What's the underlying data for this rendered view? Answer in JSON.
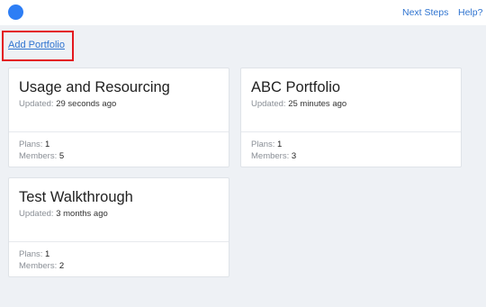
{
  "header": {
    "next_steps": "Next Steps",
    "help": "Help?"
  },
  "main": {
    "add_portfolio": "Add Portfolio",
    "updated_label": "Updated:",
    "plans_label": "Plans:",
    "members_label": "Members:",
    "portfolios": [
      {
        "title": "Usage and Resourcing",
        "updated": "29 seconds ago",
        "plans": "1",
        "members": "5"
      },
      {
        "title": "ABC Portfolio",
        "updated": "25 minutes ago",
        "plans": "1",
        "members": "3"
      },
      {
        "title": "Test Walkthrough",
        "updated": "3 months ago",
        "plans": "1",
        "members": "2"
      }
    ]
  },
  "colors": {
    "accent": "#2d7ef5",
    "link": "#2f74d0",
    "highlight": "#e3191f",
    "background": "#eef1f5"
  }
}
